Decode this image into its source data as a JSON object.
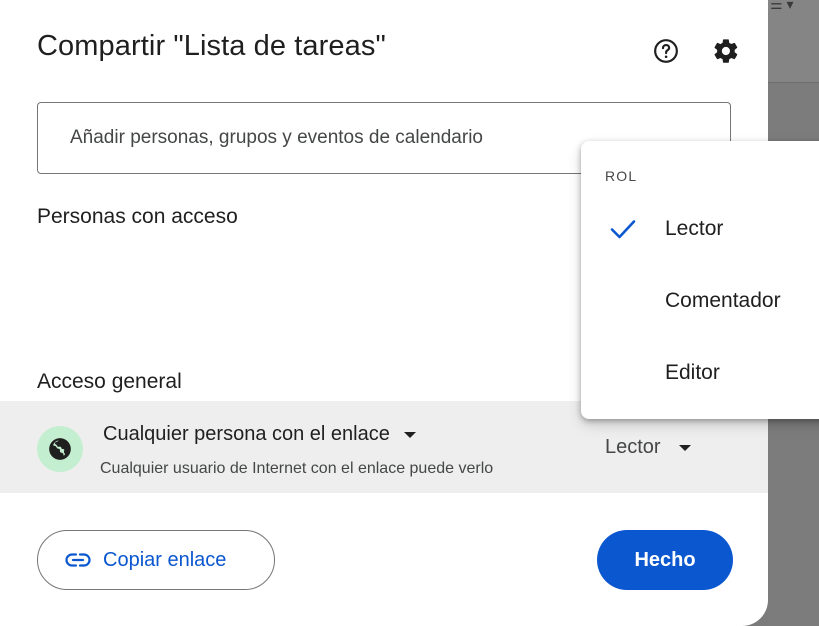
{
  "dialog": {
    "title": "Compartir \"Lista de tareas\"",
    "add_people_placeholder": "Añadir personas, grupos y eventos de calendario",
    "people_with_access_heading": "Personas con acceso",
    "general_access_heading": "Acceso general",
    "general_access": {
      "type_label": "Cualquier persona con el enlace",
      "description": "Cualquier usuario de Internet con el enlace puede verlo",
      "role_label": "Lector"
    },
    "copy_link_label": "Copiar enlace",
    "done_label": "Hecho"
  },
  "role_menu": {
    "title": "ROL",
    "items": [
      {
        "label": "Lector",
        "selected": true
      },
      {
        "label": "Comentador",
        "selected": false
      },
      {
        "label": "Editor",
        "selected": false
      }
    ]
  },
  "icons": {
    "help": "help-circle-icon",
    "settings": "gear-icon",
    "globe": "globe-icon",
    "link": "link-icon",
    "check": "check-icon"
  },
  "colors": {
    "primary": "#0b57d0",
    "globe_badge": "#c4eed0",
    "access_row_bg": "#eeeeee"
  }
}
